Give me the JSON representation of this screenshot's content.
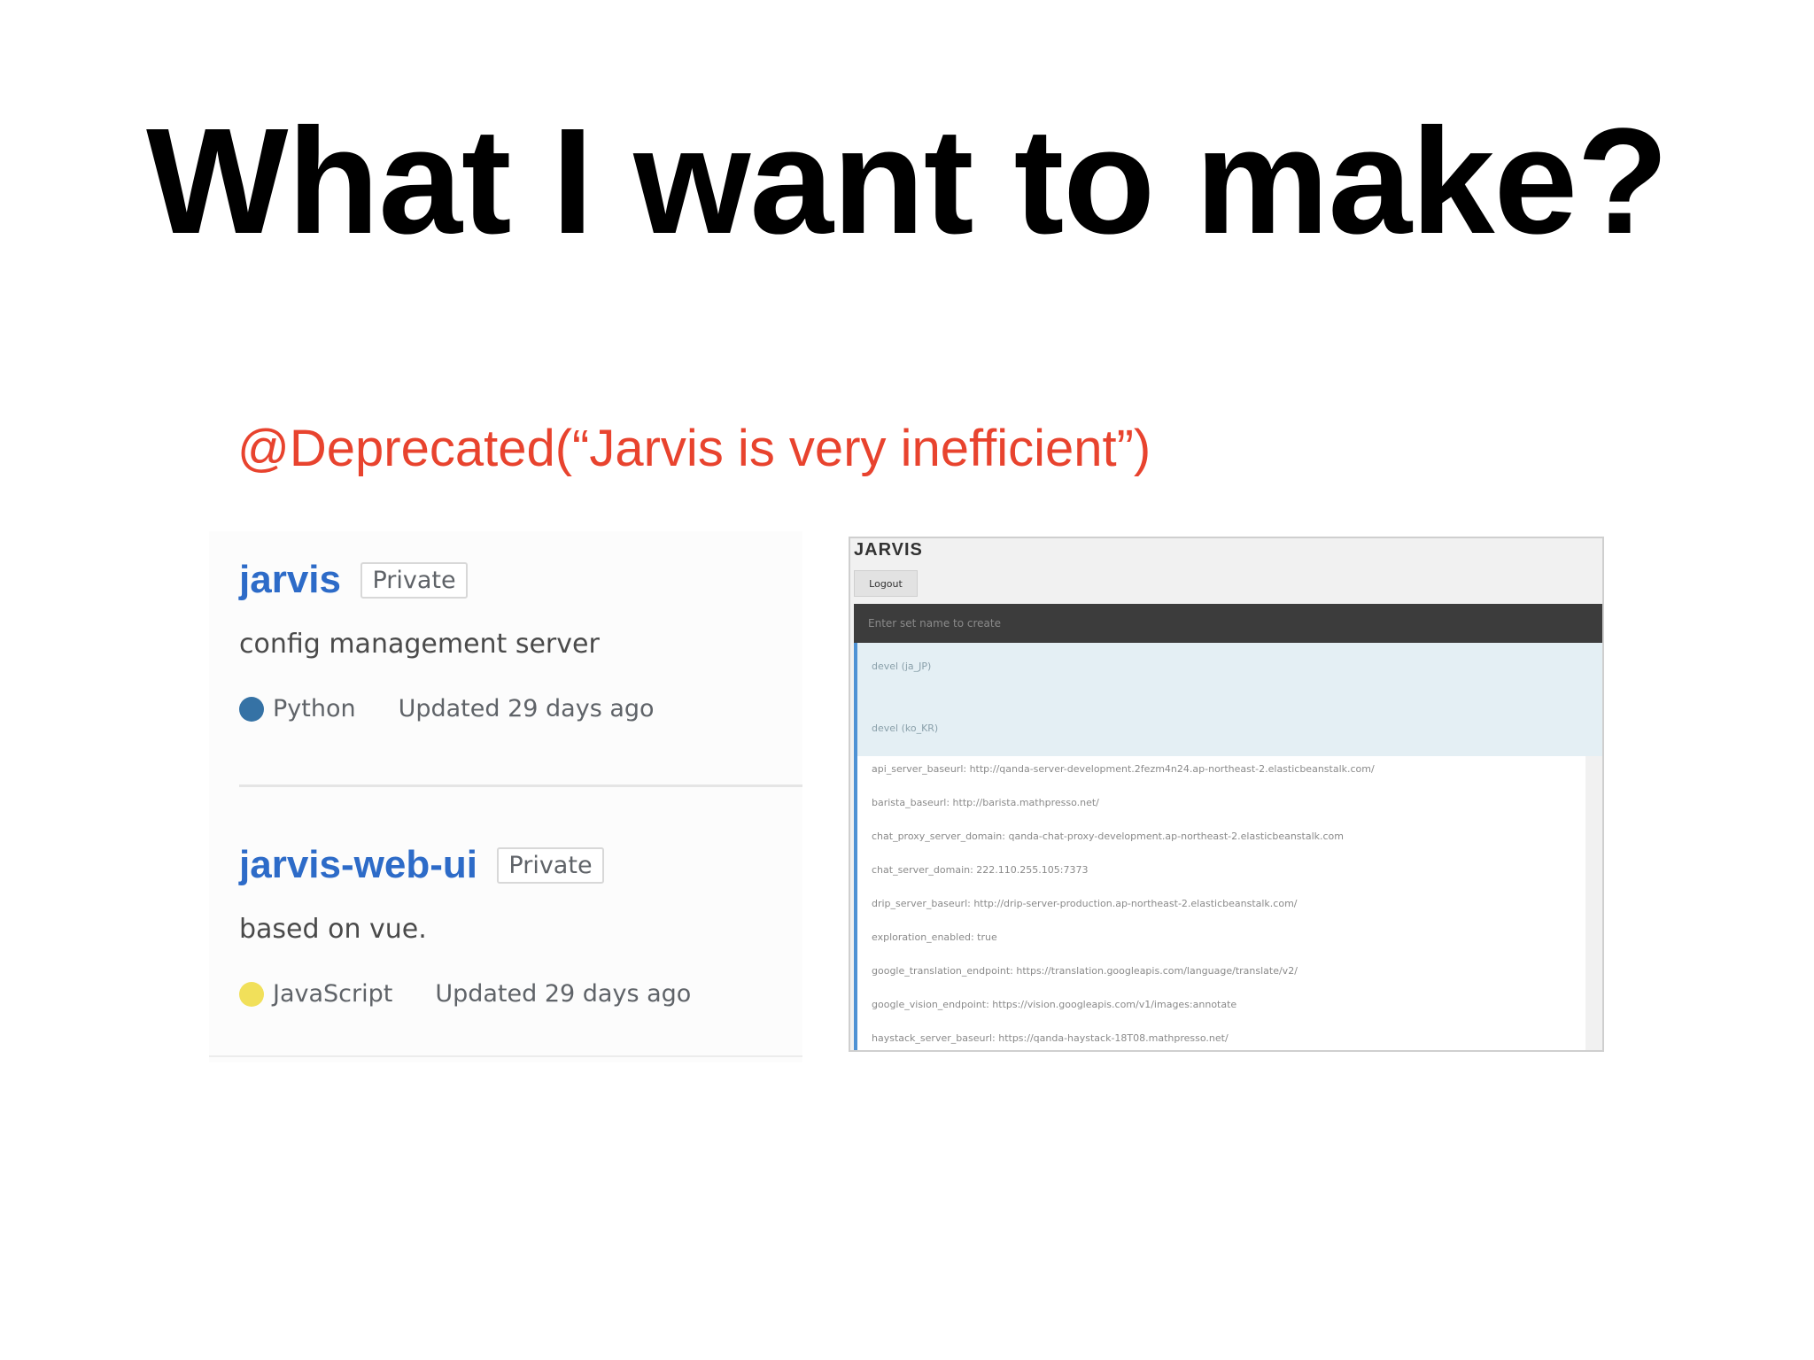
{
  "slide": {
    "title": "What I want to make?",
    "annotation": "@Deprecated(“Jarvis is very inefficient”)"
  },
  "repos": [
    {
      "name": "jarvis",
      "badge": "Private",
      "description": "config management server",
      "language": "Python",
      "language_color": "#3572A5",
      "updated": "Updated 29 days ago"
    },
    {
      "name": "jarvis-web-ui",
      "badge": "Private",
      "description": "based on vue.",
      "language": "JavaScript",
      "language_color": "#f1e05a",
      "updated": "Updated 29 days ago"
    }
  ],
  "jarvis_app": {
    "title": "JARVIS",
    "logout_label": "Logout",
    "search_placeholder": "Enter set name to create",
    "environments": [
      "devel (ja_JP)",
      "devel (ko_KR)"
    ],
    "config_items": [
      "api_server_baseurl: http://qanda-server-development.2fezm4n24.ap-northeast-2.elasticbeanstalk.com/",
      "barista_baseurl: http://barista.mathpresso.net/",
      "chat_proxy_server_domain: qanda-chat-proxy-development.ap-northeast-2.elasticbeanstalk.com",
      "chat_server_domain: 222.110.255.105:7373",
      "drip_server_baseurl: http://drip-server-production.ap-northeast-2.elasticbeanstalk.com/",
      "exploration_enabled: true",
      "google_translation_endpoint: https://translation.googleapis.com/language/translate/v2/",
      "google_vision_endpoint: https://vision.googleapis.com/v1/images:annotate",
      "haystack_server_baseurl: https://qanda-haystack-18T08.mathpresso.net/"
    ]
  }
}
